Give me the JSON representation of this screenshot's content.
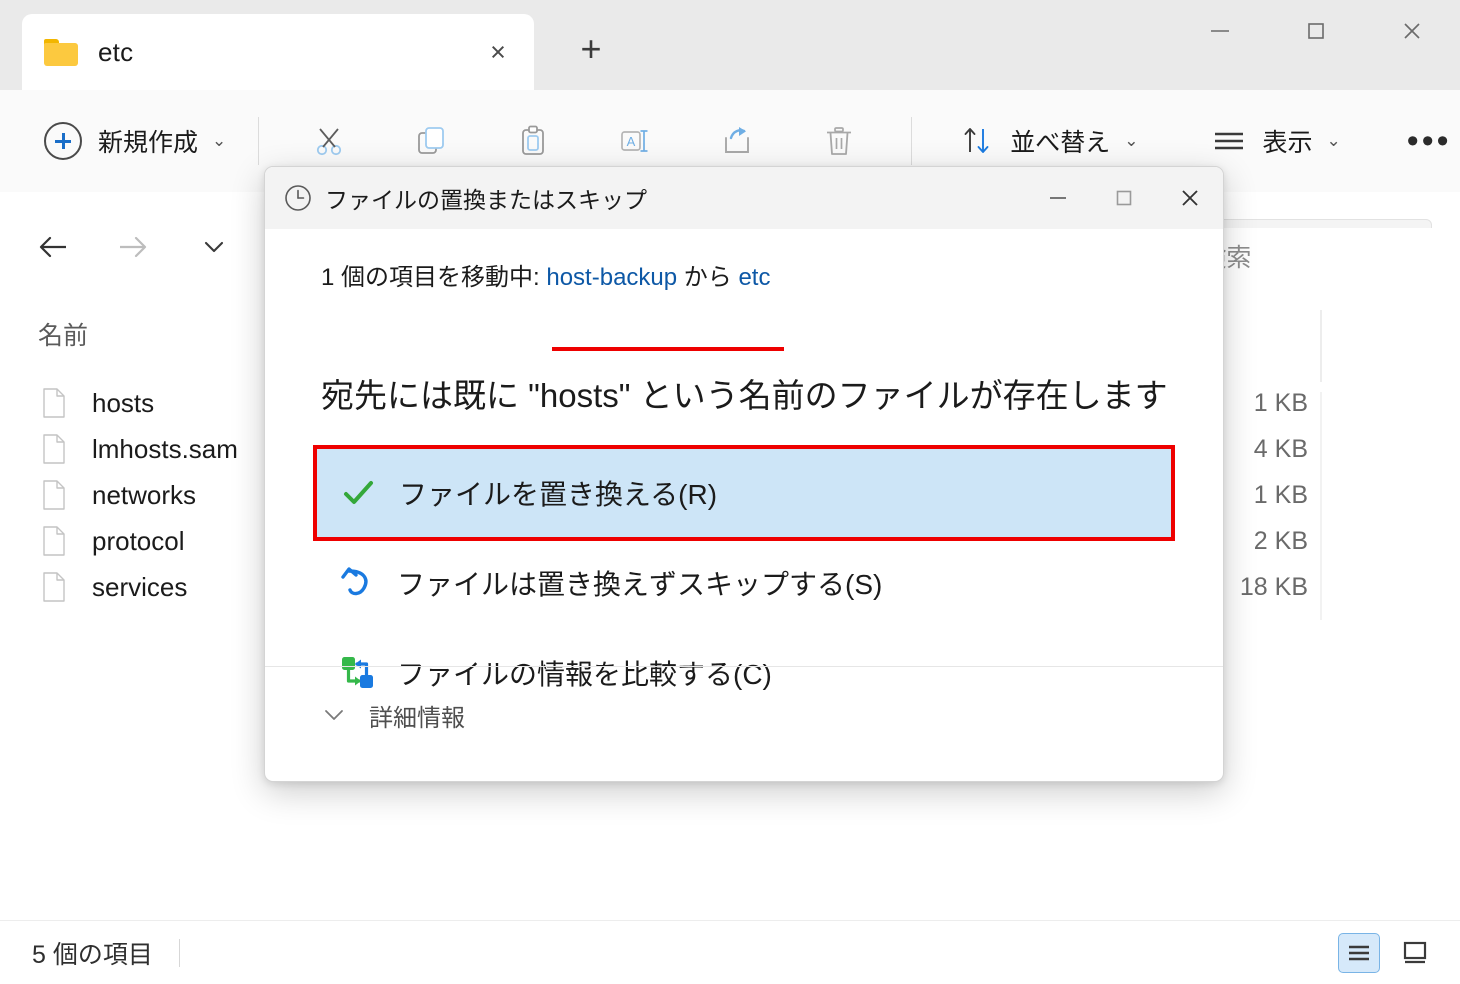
{
  "window": {
    "tab": {
      "label": "etc",
      "icon": "folder-icon",
      "close_label": "×"
    },
    "new_tab_label": "+",
    "controls": {
      "minimize": "—",
      "maximize": "□",
      "close": "×"
    }
  },
  "toolbar": {
    "new_label": "新規作成",
    "new_chevron": "⌄",
    "cut_icon": "scissors-icon",
    "copy_icon": "copy-icon",
    "paste_icon": "clipboard-icon",
    "rename_icon": "rename-icon",
    "share_icon": "share-icon",
    "delete_icon": "trash-icon",
    "sort_label": "並べ替え",
    "sort_chevron": "⌄",
    "view_label": "表示",
    "view_chevron": "⌄",
    "more_label": "•••"
  },
  "nav": {
    "back_icon": "arrow-left-icon",
    "forward_icon": "arrow-right-icon",
    "recent_icon": "chevron-down-icon",
    "up_icon": "arrow-up-icon"
  },
  "search": {
    "placeholder": "etcの検索"
  },
  "filelist": {
    "column_name": "名前",
    "rows": [
      {
        "name": "hosts",
        "size": "1 KB"
      },
      {
        "name": "lmhosts.sam",
        "size": "4 KB"
      },
      {
        "name": "networks",
        "size": "1 KB"
      },
      {
        "name": "protocol",
        "size": "2 KB"
      },
      {
        "name": "services",
        "size": "18 KB"
      }
    ]
  },
  "statusbar": {
    "item_count": "5 個の項目",
    "details_view_icon": "details-view-icon",
    "large_icons_view_icon": "large-icons-view-icon"
  },
  "dialog": {
    "title": "ファイルの置換またはスキップ",
    "title_icon": "clock-icon",
    "controls": {
      "minimize": "—",
      "maximize": "□",
      "close": "×"
    },
    "subline_prefix": "1 個の項目を移動中: ",
    "subline_source": "host-backup",
    "subline_mid": " から ",
    "subline_dest": "etc",
    "question": "宛先には既に \"hosts\" という名前のファイルが存在します",
    "options": [
      {
        "label": "ファイルを置き換える(R)",
        "icon": "checkmark-icon",
        "selected": true
      },
      {
        "label": "ファイルは置き換えずスキップする(S)",
        "icon": "skip-undo-icon",
        "selected": false
      },
      {
        "label": "ファイルの情報を比較する(C)",
        "icon": "compare-files-icon",
        "selected": false
      }
    ],
    "more_info_label": "詳細情報",
    "more_info_chevron": "⌄"
  },
  "colors": {
    "highlight_bg": "#cde5f7",
    "annotation_red": "#ee0000",
    "link_blue": "#0d58a6",
    "accent_blue": "#1a6ec8",
    "check_green": "#34a83a"
  }
}
